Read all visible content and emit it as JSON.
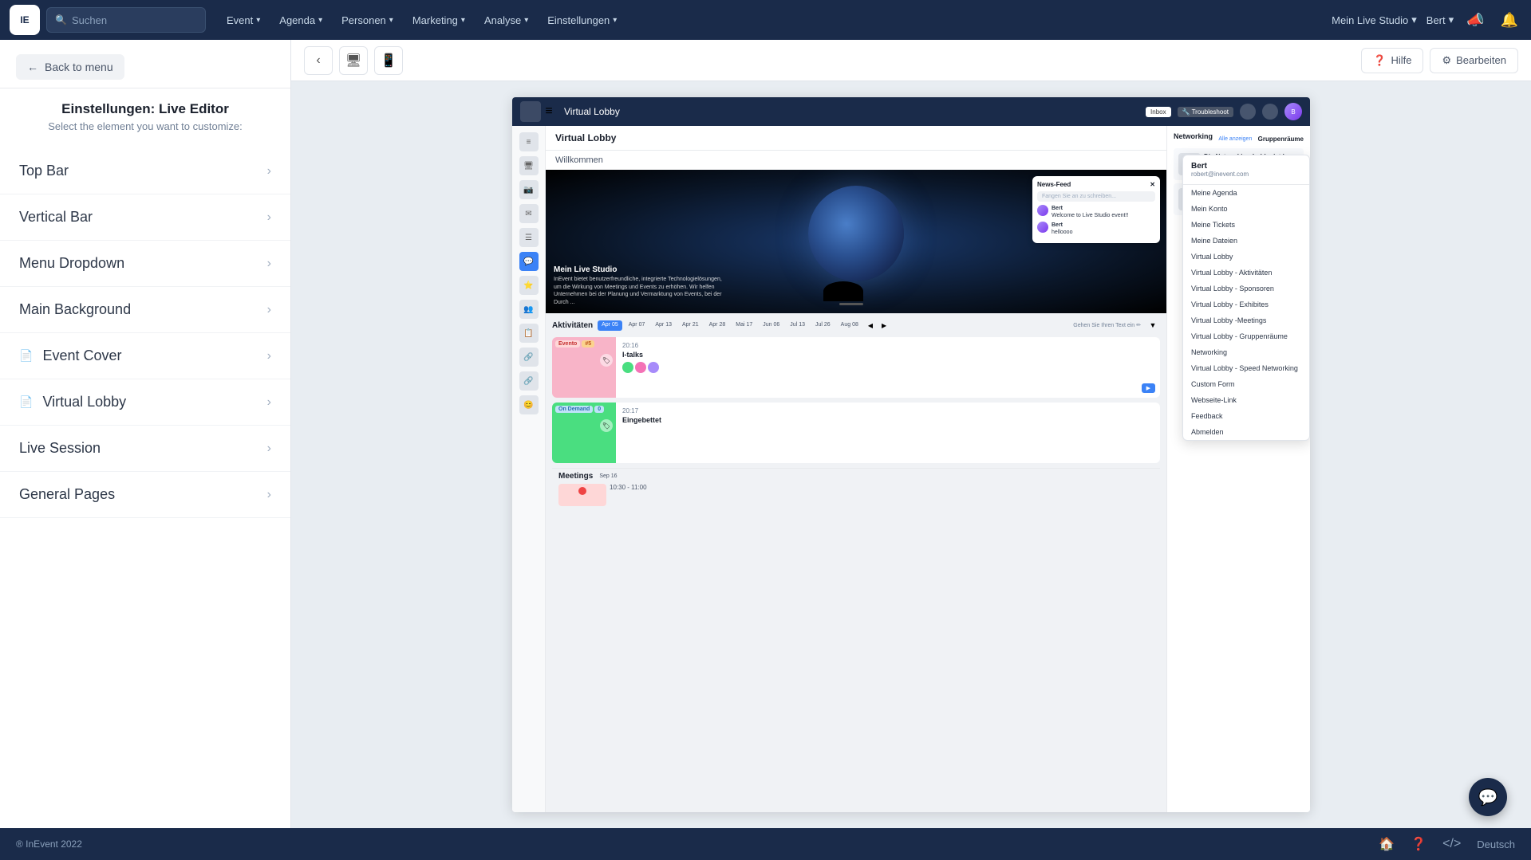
{
  "nav": {
    "logo_text": "IE",
    "search_placeholder": "Suchen",
    "items": [
      {
        "label": "Event",
        "has_dropdown": true
      },
      {
        "label": "Agenda",
        "has_dropdown": true
      },
      {
        "label": "Personen",
        "has_dropdown": true
      },
      {
        "label": "Marketing",
        "has_dropdown": true
      },
      {
        "label": "Analyse",
        "has_dropdown": true
      },
      {
        "label": "Einstellungen",
        "has_dropdown": true
      }
    ],
    "right_items": [
      {
        "label": "Mein Live Studio",
        "has_dropdown": true
      },
      {
        "label": "Bert",
        "has_dropdown": true
      }
    ]
  },
  "toolbar": {
    "help_label": "Hilfe",
    "edit_label": "Bearbeiten"
  },
  "sidebar": {
    "back_label": "Back to menu",
    "title": "Einstellungen: Live Editor",
    "subtitle": "Select the element you want to customize:",
    "items": [
      {
        "label": "Top Bar",
        "has_icon": false
      },
      {
        "label": "Vertical Bar",
        "has_icon": false
      },
      {
        "label": "Menu Dropdown",
        "has_icon": false
      },
      {
        "label": "Main Background",
        "has_icon": false
      },
      {
        "label": "Event Cover",
        "has_icon": true
      },
      {
        "label": "Virtual Lobby",
        "has_icon": true
      },
      {
        "label": "Live Session",
        "has_icon": false
      },
      {
        "label": "General Pages",
        "has_icon": false
      }
    ]
  },
  "preview": {
    "topbar_title": "Virtual Lobby",
    "welcome_text": "Willkommen",
    "hero_title": "Mein Live Studio",
    "hero_desc": "InEvent bietet benutzerfreundliche, integrierte Technologielösungen, um die Wirkung von Meetings und Events zu erhöhen. Wir helfen Unternehmen bei der Planung und Vermarktung von Events, bei der Durch ...",
    "news_feed_label": "News-Feed",
    "news_input_placeholder": "Fangen Sie an zu schreiben...",
    "messages": [
      {
        "name": "Bert",
        "text": "Welcome to Live Studio event!!"
      },
      {
        "name": "Bert",
        "text": "helloooo"
      }
    ],
    "activities_label": "Aktivitäten",
    "tab_active": "Apr 05",
    "date_tabs": [
      "Apr 07",
      "Apr 13",
      "Apr 21",
      "Apr 28",
      "Mai 17",
      "Jun 06",
      "Jul 13",
      "Jul 26",
      "Aug 08"
    ],
    "cards": [
      {
        "badge1": "Evento",
        "badge2": "#5",
        "time": "20:16",
        "name": "I-talks",
        "thumb_color": "pink"
      },
      {
        "badge1": "On Demand",
        "badge2": "0",
        "time": "20:17",
        "name": "Eingebettet",
        "thumb_color": "green"
      }
    ],
    "networking_label": "Networking",
    "gruppenraume_label": "Gruppenräume",
    "dropdown": {
      "name": "Bert",
      "email": "robert@inevent.com",
      "items": [
        "Meine Agenda",
        "Mein Konto",
        "Meine Tickets",
        "Meine Dateien",
        "Virtual Lobby",
        "Virtual Lobby - Aktivitäten",
        "Virtual Lobby - Sponsoren",
        "Virtual Lobby - Exhibites",
        "Virtual Lobby -Meetings",
        "Virtual Lobby - Gruppenräume",
        "Networking",
        "Virtual Lobby - Speed Networking",
        "Custom Form",
        "Webseite-Link",
        "Feedback",
        "Abmelden"
      ]
    },
    "meetings_label": "Meetings",
    "meetings_badge": "Sep 16",
    "meetings_time": "10:30 - 11:00"
  },
  "footer": {
    "copyright": "® InEvent 2022",
    "lang": "Deutsch"
  }
}
